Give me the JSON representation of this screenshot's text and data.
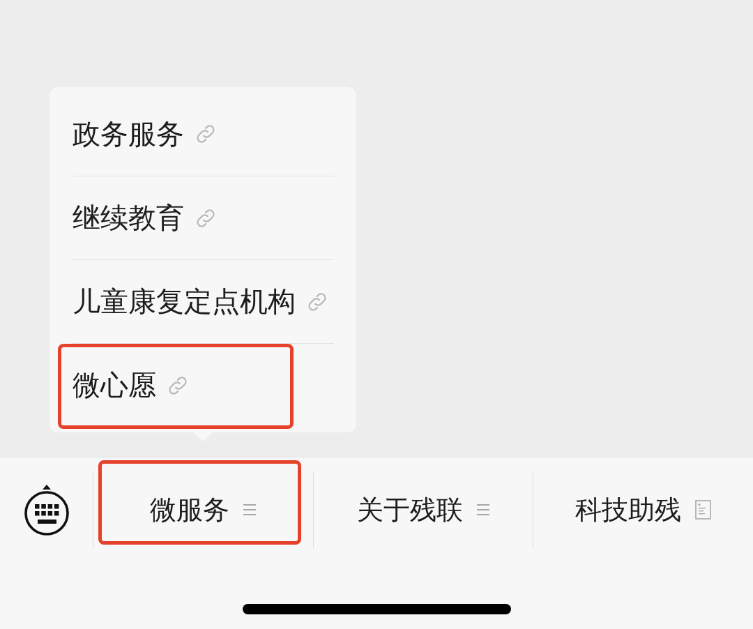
{
  "bottom_bar": {
    "tabs": [
      {
        "label": "微服务",
        "kind": "menu",
        "expanded": true,
        "highlighted": true,
        "menu_items": [
          {
            "label": "政务服务",
            "highlighted": false
          },
          {
            "label": "继续教育",
            "highlighted": false
          },
          {
            "label": "儿童康复定点机构",
            "highlighted": false
          },
          {
            "label": "微心愿",
            "highlighted": true
          }
        ]
      },
      {
        "label": "关于残联",
        "kind": "menu",
        "expanded": false,
        "highlighted": false
      },
      {
        "label": "科技助残",
        "kind": "page",
        "expanded": false,
        "highlighted": false
      }
    ]
  }
}
